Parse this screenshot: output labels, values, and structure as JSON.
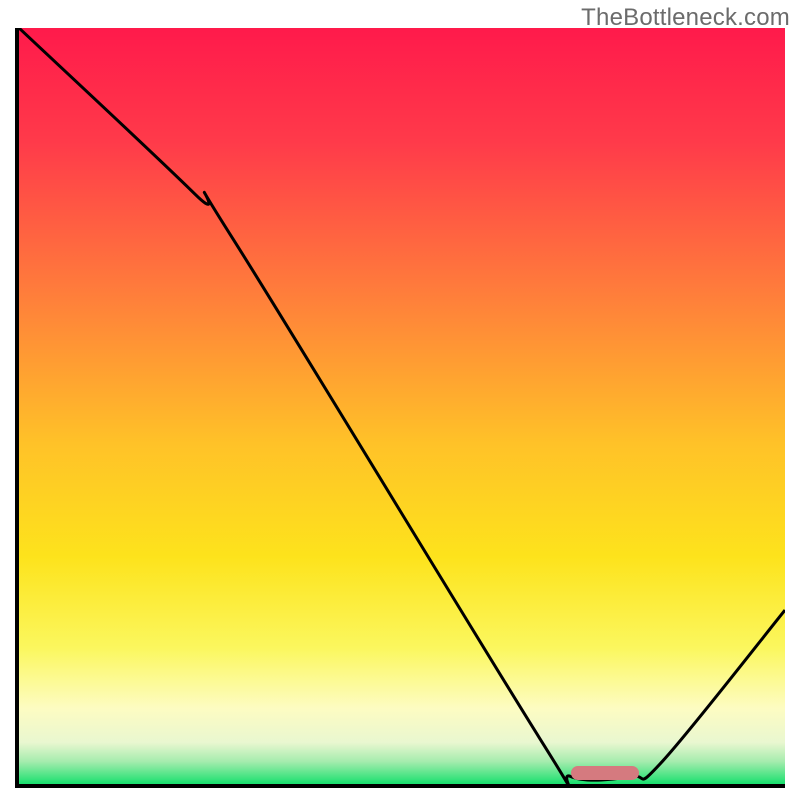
{
  "watermark": "TheBottleneck.com",
  "chart_data": {
    "type": "line",
    "title": "",
    "xlabel": "",
    "ylabel": "",
    "xlim": [
      0,
      100
    ],
    "ylim": [
      0,
      100
    ],
    "curve_points": [
      {
        "x": 0,
        "y": 100
      },
      {
        "x": 23,
        "y": 78
      },
      {
        "x": 28,
        "y": 72
      },
      {
        "x": 68,
        "y": 6
      },
      {
        "x": 72,
        "y": 1
      },
      {
        "x": 80,
        "y": 1
      },
      {
        "x": 84,
        "y": 3
      },
      {
        "x": 100,
        "y": 23
      }
    ],
    "marker": {
      "x_start": 72,
      "x_end": 81,
      "y": 1.5,
      "color": "#d57a7f"
    },
    "gradient_stops": [
      {
        "offset": 0.0,
        "color": "#ff1a4b"
      },
      {
        "offset": 0.15,
        "color": "#ff3a4a"
      },
      {
        "offset": 0.35,
        "color": "#ff7d3b"
      },
      {
        "offset": 0.55,
        "color": "#ffc228"
      },
      {
        "offset": 0.7,
        "color": "#fde31c"
      },
      {
        "offset": 0.82,
        "color": "#fbf75e"
      },
      {
        "offset": 0.9,
        "color": "#fdfcc2"
      },
      {
        "offset": 0.945,
        "color": "#e9f7d0"
      },
      {
        "offset": 0.97,
        "color": "#a6ecae"
      },
      {
        "offset": 1.0,
        "color": "#19e06e"
      }
    ],
    "curve_color": "#000000",
    "curve_width": 3
  }
}
